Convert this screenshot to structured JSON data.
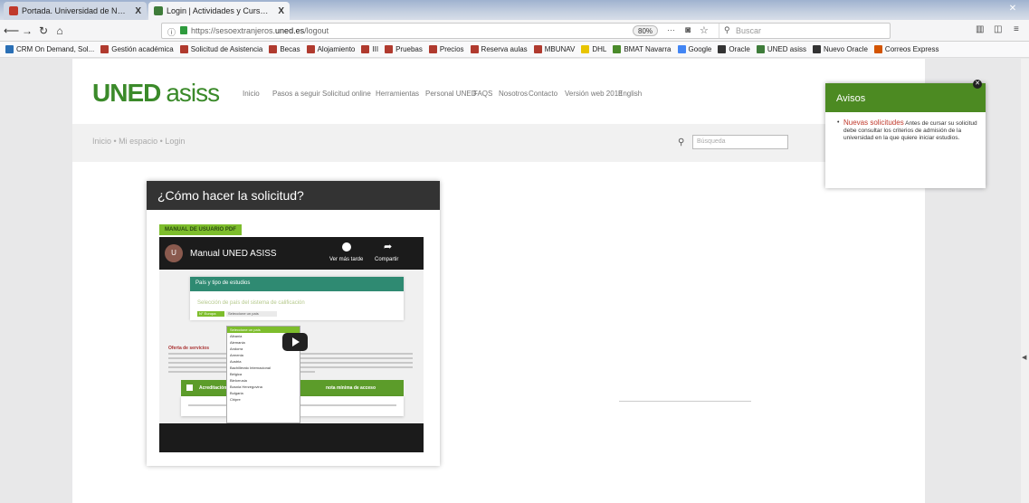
{
  "browser": {
    "tabs": [
      {
        "title": "Portada. Universidad de Navarra",
        "close": "X"
      },
      {
        "title": "Login | Actividades y Cursos | UNED",
        "close": "X"
      }
    ],
    "url_prefix": "https://sesoextranjeros.",
    "url_domain": "uned.es",
    "url_path": "/logout",
    "zoom": "80%",
    "search_placeholder": "Buscar"
  },
  "bookmarks": [
    {
      "label": "CRM On Demand, Sol...",
      "color": "#2a6fb5"
    },
    {
      "label": "Gestión académica",
      "color": "#b03a2e"
    },
    {
      "label": "Solicitud de Asistencia",
      "color": "#b03a2e"
    },
    {
      "label": "Becas",
      "color": "#b03a2e"
    },
    {
      "label": "Alojamiento",
      "color": "#b03a2e"
    },
    {
      "label": "III",
      "color": "#b03a2e"
    },
    {
      "label": "Pruebas",
      "color": "#b03a2e"
    },
    {
      "label": "Precios",
      "color": "#b03a2e"
    },
    {
      "label": "Reserva aulas",
      "color": "#b03a2e"
    },
    {
      "label": "MBUNAV",
      "color": "#b03a2e"
    },
    {
      "label": "DHL",
      "color": "#e8c400"
    },
    {
      "label": "BMAT Navarra",
      "color": "#4a8a2a"
    },
    {
      "label": "Google",
      "color": "#4285f4"
    },
    {
      "label": "Oracle",
      "color": "#333333"
    },
    {
      "label": "UNED asiss",
      "color": "#3e7c3a"
    },
    {
      "label": "Nuevo Oracle",
      "color": "#333333"
    },
    {
      "label": "Correos Express",
      "color": "#d35400"
    }
  ],
  "site": {
    "logo_main": "UNED",
    "logo_sub": "asiss",
    "nav": [
      "Inicio",
      "Pasos a seguir",
      "Solicitud online",
      "Herramientas",
      "Personal UNED",
      "FAQS",
      "Nosotros",
      "Contacto",
      "Versión web 2018",
      "English"
    ],
    "breadcrumb": "Inicio  •  Mi espacio  •  Login",
    "search_placeholder": "Búsqueda"
  },
  "avisos": {
    "title": "Avisos",
    "highlight": "Nuevas solicitudes",
    "text": "Antes de cursar su solicitud debe consultar los criterios de admisión de la universidad en la que quiere iniciar estudios."
  },
  "video_card": {
    "title": "¿Cómo hacer la solicitud?",
    "pdf_button": "MANUAL DE USUARIO PDF",
    "video_title": "Manual UNED ASISS",
    "avatar_letter": "U",
    "watch_later": "Ver más tarde",
    "share": "Compartir",
    "inner_panel_title": "País y tipo de estudios",
    "inner_panel_label": "Selección de país del sistema de calificación",
    "inner_tag": "N° Europa",
    "inner_dropdown": "Seleccione un país",
    "dropdown_items": [
      "Seleccione un país",
      "Albania",
      "Alemania",
      "Andorra",
      "Armenia",
      "Austria",
      "Bachillerato Internacional",
      "Bélgica",
      "Bielorrusia",
      "Bosnia Herzegovina",
      "Bulgaria",
      "Chipre"
    ],
    "inner_section_title": "Oferta de servicios",
    "inner_green_left": "Acreditación",
    "inner_green_right": "nota mínima de acceso"
  }
}
